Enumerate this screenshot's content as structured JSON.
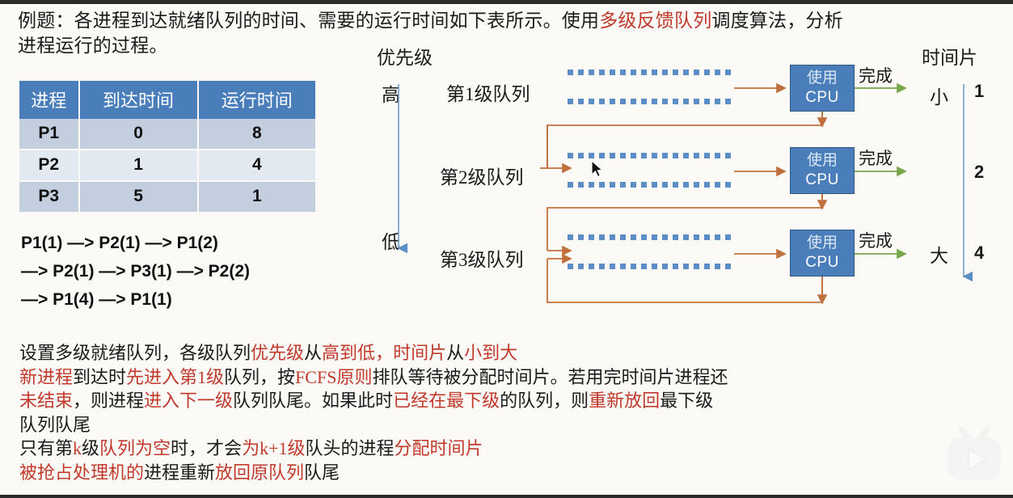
{
  "heading": {
    "part1": "例题：各进程到达就绪队列的时间、需要的运行时间如下表所示。使用",
    "highlight": "多级反馈队列",
    "part2": "调度算法，分析",
    "line2": "进程运行的过程。"
  },
  "table": {
    "headers": [
      "进程",
      "到达时间",
      "运行时间"
    ],
    "rows": [
      [
        "P1",
        "0",
        "8"
      ],
      [
        "P2",
        "1",
        "4"
      ],
      [
        "P3",
        "5",
        "1"
      ]
    ]
  },
  "sequence": [
    "P1(1) —> P2(1) —> P1(2)",
    "—> P2(1) —> P3(1) —> P2(2)",
    "—> P1(4) —> P1(1)"
  ],
  "diagram": {
    "priority_title": "优先级",
    "priority_high": "高",
    "priority_low": "低",
    "timeslice_title": "时间片",
    "timeslice_small": "小",
    "timeslice_large": "大",
    "timeslice_values": [
      "1",
      "2",
      "4"
    ],
    "queues": [
      {
        "label": "第1级队列",
        "cpu_line1": "使用",
        "cpu_line2": "CPU",
        "done": "完成"
      },
      {
        "label": "第2级队列",
        "cpu_line1": "使用",
        "cpu_line2": "CPU",
        "done": "完成"
      },
      {
        "label": "第3级队列",
        "cpu_line1": "使用",
        "cpu_line2": "CPU",
        "done": "完成"
      }
    ]
  },
  "explain": {
    "l1a": "设置多级就绪队列，各级队列",
    "l1b": "优先级",
    "l1c": "从",
    "l1d": "高到低",
    "l1e": "，",
    "l1f": "时间片",
    "l1g": "从",
    "l1h": "小到大",
    "l2a": "新进程",
    "l2b": "到达时",
    "l2c": "先进入第1级",
    "l2d": "队列，按",
    "l2e": "FCFS原则",
    "l2f": "排队等待被分配时间片。若用完时间片进程还",
    "l3a": "未结束",
    "l3b": "，则进程",
    "l3c": "进入下一级",
    "l3d": "队列队尾。如果此时",
    "l3e": "已经在最下级",
    "l3f": "的队列，则",
    "l3g": "重新放回",
    "l3h": "最下级",
    "l4": "队列队尾",
    "l5a": "只有第",
    "l5b": "k",
    "l5c": "级",
    "l5d": "队列为空",
    "l5e": "时，才会",
    "l5f": "为",
    "l5g": "k+1",
    "l5h": "级",
    "l5i": "队头的进程",
    "l5j": "分配时间片",
    "l6a": "被抢占处理机的",
    "l6b": "进程重新",
    "l6c": "放回原队列",
    "l6d": "队尾"
  },
  "colors": {
    "accent_blue": "#4a7ebb",
    "arrow_orange": "#c0703c",
    "arrow_green": "#77a64b",
    "highlight_red": "#c0392b",
    "dotted_blue": "#5b8dc6"
  }
}
